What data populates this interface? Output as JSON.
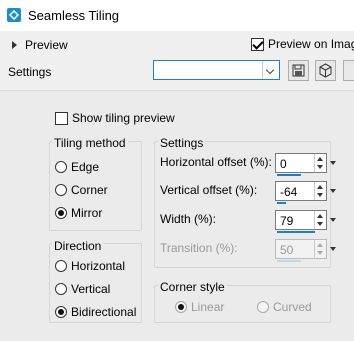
{
  "window": {
    "title": "Seamless Tiling",
    "icon": "tiling-app-icon"
  },
  "preview": {
    "toggle_label": "Preview",
    "on_image_label": "Preview on Image",
    "on_image_checked": true
  },
  "presets": {
    "label": "Settings",
    "selected_value": "",
    "save_icon": "floppy-disk-icon",
    "randomize_icon": "dice-cube-icon"
  },
  "show_tiling_preview": {
    "label": "Show tiling preview",
    "checked": false
  },
  "tiling_method": {
    "title": "Tiling method",
    "options": [
      "Edge",
      "Corner",
      "Mirror"
    ],
    "selected": "Mirror"
  },
  "direction": {
    "title": "Direction",
    "options": [
      "Horizontal",
      "Vertical",
      "Bidirectional"
    ],
    "selected": "Bidirectional"
  },
  "settings": {
    "title": "Settings",
    "horizontal_offset": {
      "label": "Horizontal offset (%):",
      "value": "0"
    },
    "vertical_offset": {
      "label": "Vertical offset (%):",
      "value": "-64"
    },
    "width": {
      "label": "Width (%):",
      "value": "79"
    },
    "transition": {
      "label": "Transition (%):",
      "value": "50",
      "disabled": true
    }
  },
  "corner_style": {
    "title": "Corner style",
    "options": [
      "Linear",
      "Curved"
    ],
    "selected": "Linear",
    "disabled": true
  },
  "colors": {
    "accent": "#1e7fc8",
    "panel": "#ebebeb",
    "title_bg": "#ffffff"
  }
}
